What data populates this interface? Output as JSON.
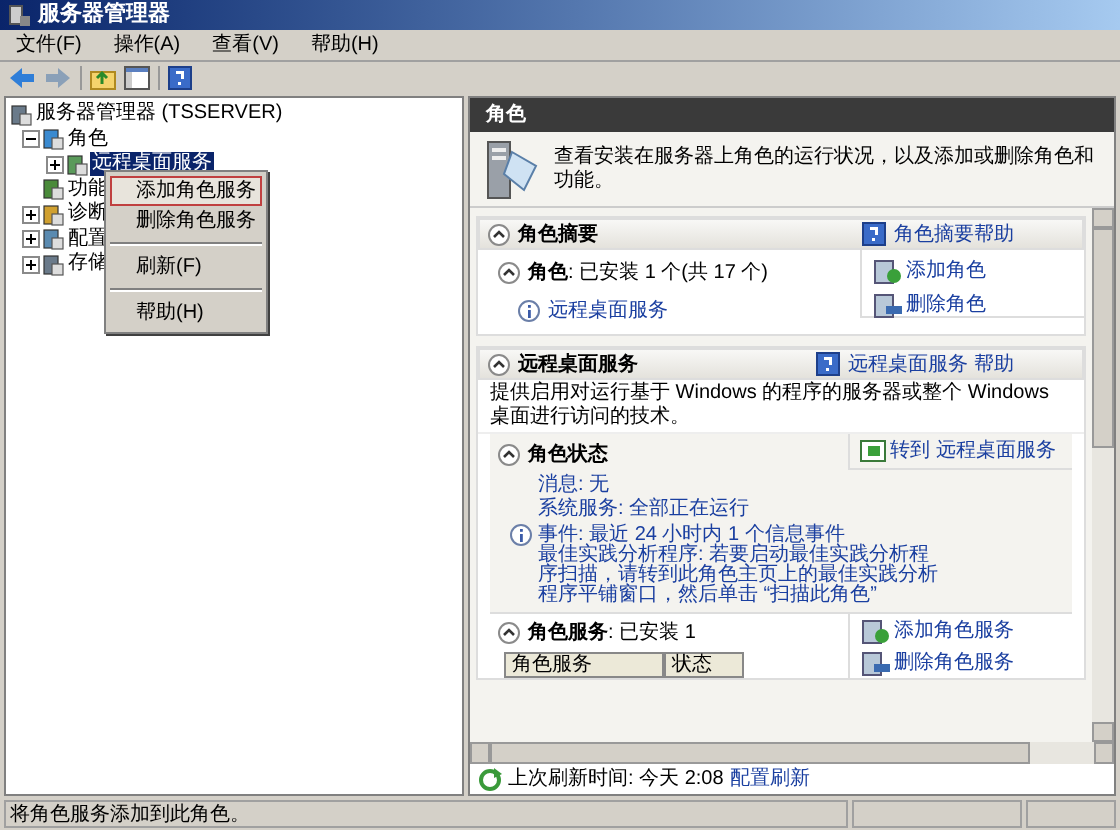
{
  "window": {
    "title": "服务器管理器"
  },
  "menu_bar": [
    "文件(F)",
    "操作(A)",
    "查看(V)",
    "帮助(H)"
  ],
  "tree": [
    {
      "label": "服务器管理器 (TSSERVER)",
      "selected": false,
      "children": [
        {
          "label": "角色",
          "expanded": true,
          "selected": false,
          "children": [
            {
              "label": "远程桌面服务",
              "expanded": false,
              "selected": true
            }
          ]
        },
        {
          "label": "功能",
          "selected": false
        },
        {
          "label": "诊断",
          "expanded": false,
          "selected": false
        },
        {
          "label": "配置",
          "expanded": false,
          "selected": false
        },
        {
          "label": "存储",
          "expanded": false,
          "selected": false
        }
      ]
    }
  ],
  "context_menu": [
    {
      "kind": "item",
      "label": "添加角色服务",
      "selected": true
    },
    {
      "kind": "item",
      "label": "删除角色服务",
      "selected": false
    },
    {
      "kind": "separator"
    },
    {
      "kind": "item",
      "label": "刷新(F)",
      "selected": false
    },
    {
      "kind": "separator"
    },
    {
      "kind": "item",
      "label": "帮助(H)",
      "selected": false
    }
  ],
  "content": {
    "header": "角色",
    "description": "查看安装在服务器上角色的运行状况，以及添加或删除角色和功能。",
    "summary": {
      "title": "角色摘要",
      "help_link": "角色摘要帮助",
      "roles_line": "**角色**: 已安装 1 个(共 17 个)",
      "roles": [
        "远程桌面服务"
      ],
      "actions": [
        "添加角色",
        "删除角色"
      ]
    },
    "service": {
      "title": "远程桌面服务",
      "help_link": "远程桌面服务 帮助",
      "description": "提供启用对运行基于 Windows 的程序的服务器或整个 Windows 桌面进行访问的技术。",
      "status_title": "角色状态",
      "goto_link": "转到 远程桌面服务",
      "messages": "消息: 无",
      "system_services": "系统服务: 全部正在运行",
      "events": "事件: 最近 24 小时内 1 个信息事件",
      "bpa": "最佳实践分析程序: 若要启动最佳实践分析程序扫描，请转到此角色主页上的最佳实践分析程序平铺窗口，然后单击 “扫描此角色”",
      "role_services_line": "**角色服务**: 已安装 1",
      "columns": [
        "角色服务",
        "状态"
      ],
      "actions": [
        "添加角色服务",
        "删除角色服务"
      ]
    },
    "refresh_label": "上次刷新时间: 今天 2:08",
    "refresh_link": "配置刷新"
  },
  "status_bar": "将角色服务添加到此角色。"
}
